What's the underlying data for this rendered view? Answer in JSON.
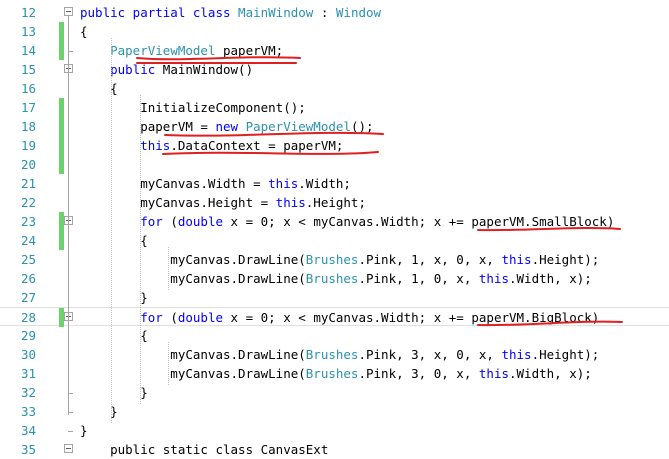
{
  "editor": {
    "lines": [
      {
        "num": "12",
        "changed": false,
        "fold": true,
        "tokens": [
          {
            "t": "public partial class ",
            "c": "kw"
          },
          {
            "t": "MainWindow",
            "c": "ty"
          },
          {
            "t": " : ",
            "c": ""
          },
          {
            "t": "Window",
            "c": "ty"
          }
        ]
      },
      {
        "num": "13",
        "changed": true,
        "tokens": [
          {
            "t": "{",
            "c": ""
          }
        ]
      },
      {
        "num": "14",
        "changed": true,
        "tokens": [
          {
            "t": "    ",
            "c": ""
          },
          {
            "t": "PaperViewModel",
            "c": "ty"
          },
          {
            "t": " paperVM;",
            "c": ""
          }
        ]
      },
      {
        "num": "15",
        "changed": false,
        "fold": true,
        "tokens": [
          {
            "t": "    ",
            "c": ""
          },
          {
            "t": "public",
            "c": "kw"
          },
          {
            "t": " MainWindow()",
            "c": ""
          }
        ]
      },
      {
        "num": "16",
        "changed": false,
        "tokens": [
          {
            "t": "    {",
            "c": ""
          }
        ]
      },
      {
        "num": "17",
        "changed": true,
        "tokens": [
          {
            "t": "        InitializeComponent();",
            "c": ""
          }
        ]
      },
      {
        "num": "18",
        "changed": true,
        "tokens": [
          {
            "t": "        paperVM = ",
            "c": ""
          },
          {
            "t": "new",
            "c": "kw"
          },
          {
            "t": " ",
            "c": ""
          },
          {
            "t": "PaperViewModel",
            "c": "ty"
          },
          {
            "t": "();",
            "c": ""
          }
        ]
      },
      {
        "num": "19",
        "changed": true,
        "tokens": [
          {
            "t": "        ",
            "c": ""
          },
          {
            "t": "this",
            "c": "kw"
          },
          {
            "t": ".DataContext = paperVM;",
            "c": ""
          }
        ]
      },
      {
        "num": "20",
        "changed": true,
        "tokens": [
          {
            "t": "",
            "c": ""
          }
        ]
      },
      {
        "num": "21",
        "changed": false,
        "tokens": [
          {
            "t": "        myCanvas.Width = ",
            "c": ""
          },
          {
            "t": "this",
            "c": "kw"
          },
          {
            "t": ".Width;",
            "c": ""
          }
        ]
      },
      {
        "num": "22",
        "changed": false,
        "tokens": [
          {
            "t": "        myCanvas.Height = ",
            "c": ""
          },
          {
            "t": "this",
            "c": "kw"
          },
          {
            "t": ".Height;",
            "c": ""
          }
        ]
      },
      {
        "num": "23",
        "changed": true,
        "fold": true,
        "tokens": [
          {
            "t": "        ",
            "c": ""
          },
          {
            "t": "for",
            "c": "kw"
          },
          {
            "t": " (",
            "c": ""
          },
          {
            "t": "double",
            "c": "kw"
          },
          {
            "t": " x = 0; x < myCanvas.Width; x += paperVM.SmallBlock)",
            "c": ""
          }
        ]
      },
      {
        "num": "24",
        "changed": true,
        "tokens": [
          {
            "t": "        {",
            "c": ""
          }
        ]
      },
      {
        "num": "25",
        "changed": false,
        "tokens": [
          {
            "t": "            myCanvas.DrawLine(",
            "c": ""
          },
          {
            "t": "Brushes",
            "c": "ty"
          },
          {
            "t": ".Pink, 1, x, 0, x, ",
            "c": ""
          },
          {
            "t": "this",
            "c": "kw"
          },
          {
            "t": ".Height);",
            "c": ""
          }
        ]
      },
      {
        "num": "26",
        "changed": false,
        "tokens": [
          {
            "t": "            myCanvas.DrawLine(",
            "c": ""
          },
          {
            "t": "Brushes",
            "c": "ty"
          },
          {
            "t": ".Pink, 1, 0, x, ",
            "c": ""
          },
          {
            "t": "this",
            "c": "kw"
          },
          {
            "t": ".Width, x);",
            "c": ""
          }
        ]
      },
      {
        "num": "27",
        "changed": false,
        "tokens": [
          {
            "t": "        }",
            "c": ""
          }
        ]
      },
      {
        "num": "28",
        "changed": true,
        "fold": true,
        "current": true,
        "tokens": [
          {
            "t": "        ",
            "c": ""
          },
          {
            "t": "for",
            "c": "kw"
          },
          {
            "t": " (",
            "c": ""
          },
          {
            "t": "double",
            "c": "kw"
          },
          {
            "t": " x = 0; x < myCanvas.Width; x += paperVM.BigBlock)",
            "c": ""
          }
        ]
      },
      {
        "num": "29",
        "changed": false,
        "tokens": [
          {
            "t": "        {",
            "c": ""
          }
        ]
      },
      {
        "num": "30",
        "changed": false,
        "tokens": [
          {
            "t": "            myCanvas.DrawLine(",
            "c": ""
          },
          {
            "t": "Brushes",
            "c": "ty"
          },
          {
            "t": ".Pink, 3, x, 0, x, ",
            "c": ""
          },
          {
            "t": "this",
            "c": "kw"
          },
          {
            "t": ".Height);",
            "c": ""
          }
        ]
      },
      {
        "num": "31",
        "changed": false,
        "tokens": [
          {
            "t": "            myCanvas.DrawLine(",
            "c": ""
          },
          {
            "t": "Brushes",
            "c": "ty"
          },
          {
            "t": ".Pink, 3, 0, x, ",
            "c": ""
          },
          {
            "t": "this",
            "c": "kw"
          },
          {
            "t": ".Width, x);",
            "c": ""
          }
        ]
      },
      {
        "num": "32",
        "changed": false,
        "tokens": [
          {
            "t": "        }",
            "c": ""
          }
        ]
      },
      {
        "num": "33",
        "changed": false,
        "tokens": [
          {
            "t": "    }",
            "c": ""
          }
        ]
      },
      {
        "num": "34",
        "changed": false,
        "tokens": [
          {
            "t": "}",
            "c": ""
          }
        ]
      },
      {
        "num": "35",
        "changed": false,
        "fold": true,
        "tokens": [
          {
            "t": "    public static class CanvasExt",
            "c": ""
          }
        ]
      }
    ]
  },
  "colors": {
    "keyword": "#0000ff",
    "type": "#2b91af",
    "line_number": "#2b91af",
    "change_marker": "#6bd36b",
    "annotation": "#e02020"
  }
}
